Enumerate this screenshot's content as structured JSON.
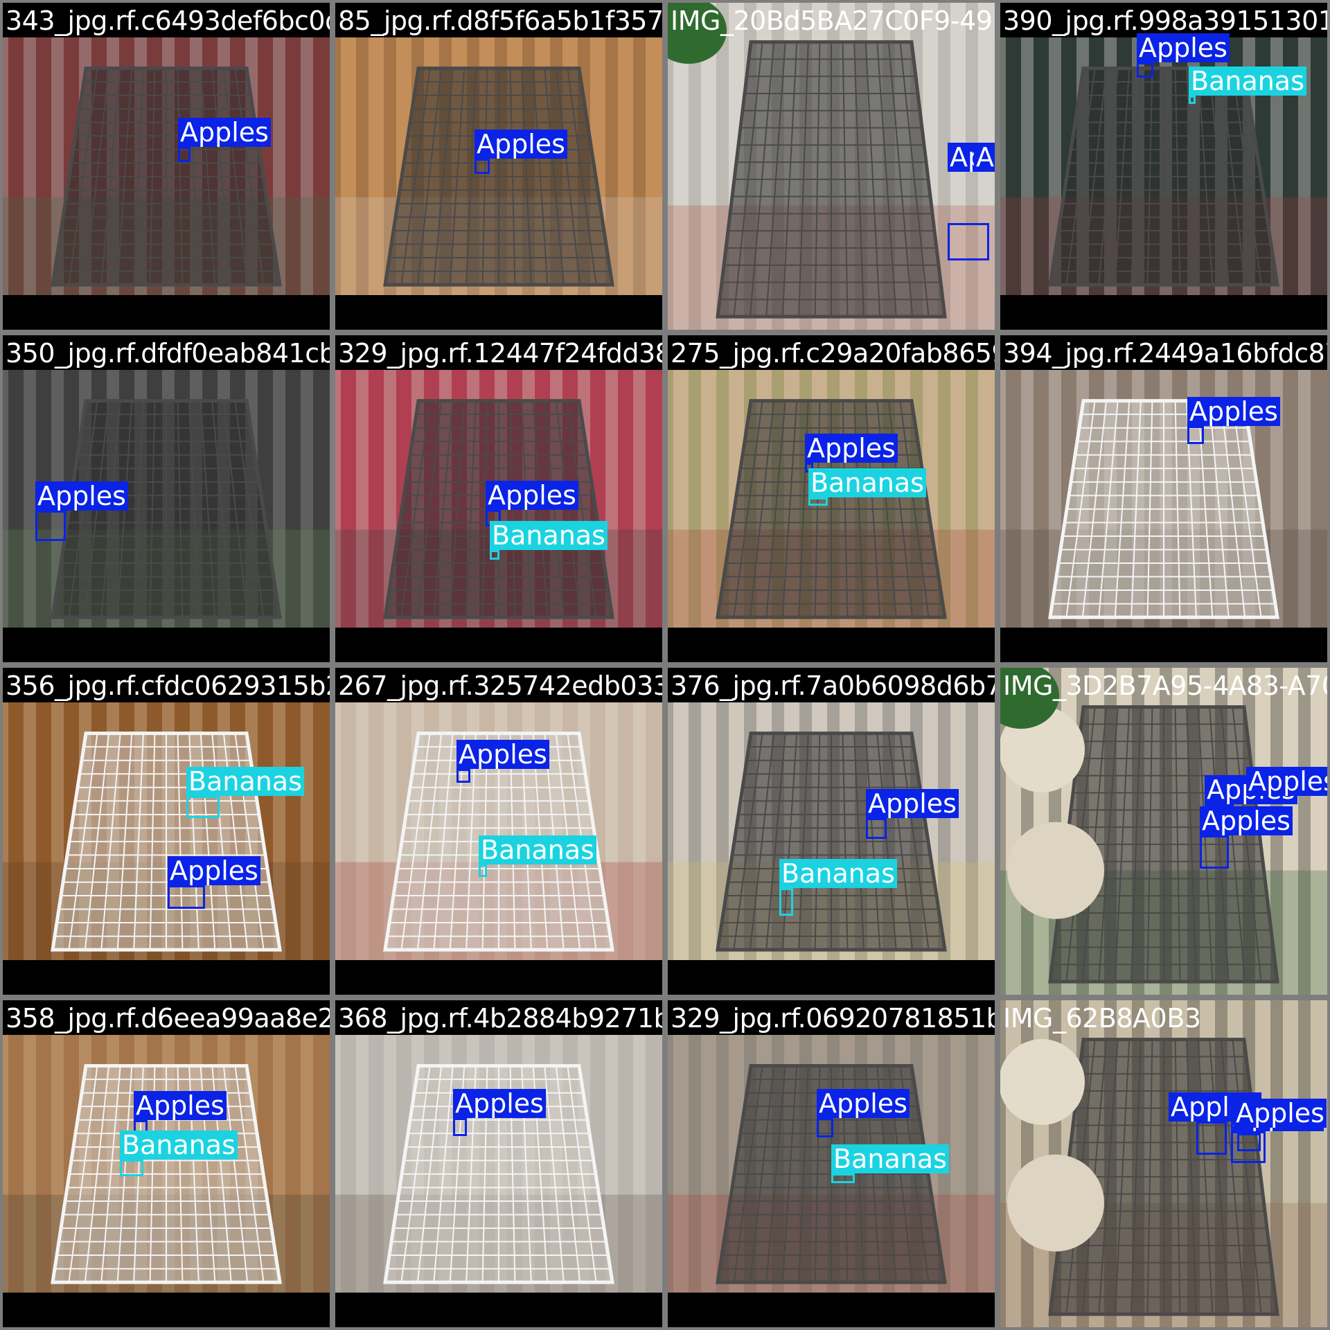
{
  "classes": {
    "Apples": {
      "color": "#0a23e6"
    },
    "Bananas": {
      "color": "#1bd3e0"
    }
  },
  "tiles": [
    {
      "filename": "343_jpg.rf.c6493def6bc0d9a85d83c885d7635",
      "scene": "cart-rotated-aisle",
      "full": false,
      "detections": [
        {
          "label": "Apples"
        }
      ]
    },
    {
      "filename": "85_jpg.rf.d8f5f6a5b1f3577864c9b5db62d",
      "scene": "cart-wood-floor",
      "full": false,
      "detections": [
        {
          "label": "Apples"
        }
      ]
    },
    {
      "filename": "IMG_20Bd5BA27C0F9-49F-B1549A2-5DE99856",
      "scene": "cart-closeup-watermelon",
      "full": true,
      "detections": [
        {
          "label": "Apples"
        },
        {
          "label": "Apples"
        }
      ]
    },
    {
      "filename": "390_jpg.rf.998a3915130106",
      "scene": "cart-checker-floor",
      "full": false,
      "detections": [
        {
          "label": "Apples"
        },
        {
          "label": "Bananas"
        }
      ]
    },
    {
      "filename": "350_jpg.rf.dfdf0eab841cbf163",
      "scene": "cart-dark-closeup",
      "full": false,
      "detections": [
        {
          "label": "Apples"
        }
      ]
    },
    {
      "filename": "329_jpg.rf.12447f24fdd3843",
      "scene": "cart-shelves",
      "full": false,
      "detections": [
        {
          "label": "Apples"
        },
        {
          "label": "Bananas"
        }
      ]
    },
    {
      "filename": "275_jpg.rf.c29a20fab865960c5",
      "scene": "cart-rotated-produce",
      "full": false,
      "detections": [
        {
          "label": "Apples"
        },
        {
          "label": "Bananas"
        }
      ]
    },
    {
      "filename": "394_jpg.rf.2449a16bfdc8781",
      "scene": "cart-white",
      "full": false,
      "detections": [
        {
          "label": "Apples"
        }
      ]
    },
    {
      "filename": "356_jpg.rf.cfdc0629315b2d0a",
      "scene": "cart-white-bread",
      "full": false,
      "detections": [
        {
          "label": "Bananas"
        },
        {
          "label": "Apples"
        }
      ]
    },
    {
      "filename": "267_jpg.rf.325742edb033e39",
      "scene": "cart-white-tiles",
      "full": false,
      "detections": [
        {
          "label": "Apples"
        },
        {
          "label": "Bananas"
        }
      ]
    },
    {
      "filename": "376_jpg.rf.7a0b6098d6b781e2",
      "scene": "cart-tile-floor",
      "full": false,
      "detections": [
        {
          "label": "Apples"
        },
        {
          "label": "Bananas"
        }
      ]
    },
    {
      "filename": "IMG_3D2B7A95-4A83-A70",
      "scene": "cart-melons",
      "full": true,
      "detections": [
        {
          "label": "Apples"
        },
        {
          "label": "Apples"
        },
        {
          "label": "Apples"
        }
      ]
    },
    {
      "filename": "358_jpg.rf.d6eea99aa8e253",
      "scene": "cart-white-bakery",
      "full": false,
      "detections": [
        {
          "label": "Apples"
        },
        {
          "label": "Bananas"
        }
      ]
    },
    {
      "filename": "368_jpg.rf.4b2884b9271ba7e",
      "scene": "cart-mall",
      "full": false,
      "detections": [
        {
          "label": "Apples"
        }
      ]
    },
    {
      "filename": "329_jpg.rf.06920781851b95073",
      "scene": "cart-wood-floor-2",
      "full": false,
      "detections": [
        {
          "label": "Apples"
        },
        {
          "label": "Bananas"
        }
      ]
    },
    {
      "filename": "IMG_62B8A0B3",
      "scene": "cart-melons-2",
      "full": true,
      "detections": [
        {
          "label": "Apples"
        },
        {
          "label": "Apples"
        },
        {
          "label": "Apples"
        }
      ]
    }
  ]
}
